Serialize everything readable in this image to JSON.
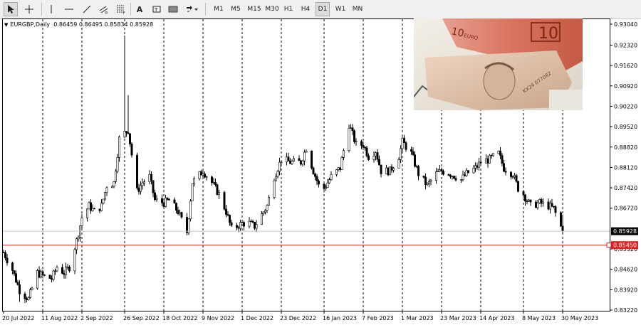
{
  "toolbar": {
    "timeframes": [
      "M1",
      "M5",
      "M15",
      "M30",
      "H1",
      "H4",
      "D1",
      "W1",
      "MN"
    ],
    "active_timeframe": "D1",
    "text_tool_label": "A"
  },
  "symbol": {
    "name": "EURGBP,Daily",
    "ohlc": "0.86459 0.86495 0.85834 0.85928"
  },
  "price_axis": {
    "ticks": [
      "0.93040",
      "0.92320",
      "0.91620",
      "0.90920",
      "0.90220",
      "0.89520",
      "0.88820",
      "0.88120",
      "0.87420",
      "0.86720",
      "0.85320",
      "0.84620",
      "0.83920",
      "0.83220"
    ],
    "current_price": "0.85928",
    "line_price": "0.85450"
  },
  "time_axis": {
    "labels": [
      "20 Jul 2022",
      "11 Aug 2022",
      "2 Sep 2022",
      "26 Sep 2022",
      "18 Oct 2022",
      "9 Nov 2022",
      "1 Dec 2022",
      "23 Dec 2022",
      "16 Jan 2023",
      "7 Feb 2023",
      "1 Mar 2023",
      "23 Mar 2023",
      "14 Apr 2023",
      "8 May 2023",
      "30 May 2023"
    ]
  },
  "colors": {
    "horizontal_line": "#e02020",
    "current_price_box": "#000000",
    "candles": "#000000"
  },
  "photo": {
    "icon": "euro-and-pound-banknotes"
  },
  "chart_data": {
    "type": "candlestick",
    "symbol": "EURGBP",
    "timeframe": "Daily",
    "ylim": [
      0.8322,
      0.9304
    ],
    "close_path": [
      [
        "2022-07-20",
        0.852
      ],
      [
        "2022-07-25",
        0.846
      ],
      [
        "2022-07-29",
        0.839
      ],
      [
        "2022-08-03",
        0.836
      ],
      [
        "2022-08-08",
        0.845
      ],
      [
        "2022-08-11",
        0.844
      ],
      [
        "2022-08-16",
        0.843
      ],
      [
        "2022-08-19",
        0.847
      ],
      [
        "2022-08-23",
        0.845
      ],
      [
        "2022-08-26",
        0.847
      ],
      [
        "2022-08-30",
        0.856
      ],
      [
        "2022-09-02",
        0.864
      ],
      [
        "2022-09-06",
        0.868
      ],
      [
        "2022-09-09",
        0.866
      ],
      [
        "2022-09-13",
        0.868
      ],
      [
        "2022-09-16",
        0.875
      ],
      [
        "2022-09-20",
        0.876
      ],
      [
        "2022-09-23",
        0.891
      ],
      [
        "2022-09-26",
        0.893
      ],
      [
        "2022-09-28",
        0.894
      ],
      [
        "2022-10-03",
        0.873
      ],
      [
        "2022-10-06",
        0.876
      ],
      [
        "2022-10-10",
        0.878
      ],
      [
        "2022-10-13",
        0.87
      ],
      [
        "2022-10-18",
        0.869
      ],
      [
        "2022-10-21",
        0.87
      ],
      [
        "2022-10-26",
        0.866
      ],
      [
        "2022-10-31",
        0.859
      ],
      [
        "2022-11-03",
        0.876
      ],
      [
        "2022-11-09",
        0.88
      ],
      [
        "2022-11-14",
        0.876
      ],
      [
        "2022-11-18",
        0.872
      ],
      [
        "2022-11-22",
        0.866
      ],
      [
        "2022-11-25",
        0.86
      ],
      [
        "2022-12-01",
        0.862
      ],
      [
        "2022-12-05",
        0.862
      ],
      [
        "2022-12-08",
        0.861
      ],
      [
        "2022-12-12",
        0.865
      ],
      [
        "2022-12-15",
        0.868
      ],
      [
        "2022-12-19",
        0.878
      ],
      [
        "2022-12-23",
        0.884
      ],
      [
        "2022-12-28",
        0.883
      ],
      [
        "2023-01-03",
        0.883
      ],
      [
        "2023-01-06",
        0.888
      ],
      [
        "2023-01-10",
        0.88
      ],
      [
        "2023-01-13",
        0.875
      ],
      [
        "2023-01-16",
        0.874
      ],
      [
        "2023-01-20",
        0.878
      ],
      [
        "2023-01-25",
        0.881
      ],
      [
        "2023-01-30",
        0.896
      ],
      [
        "2023-02-03",
        0.889
      ],
      [
        "2023-02-07",
        0.889
      ],
      [
        "2023-02-10",
        0.885
      ],
      [
        "2023-02-14",
        0.887
      ],
      [
        "2023-02-17",
        0.88
      ],
      [
        "2023-02-22",
        0.88
      ],
      [
        "2023-02-27",
        0.885
      ],
      [
        "2023-03-01",
        0.89
      ],
      [
        "2023-03-06",
        0.886
      ],
      [
        "2023-03-10",
        0.879
      ],
      [
        "2023-03-15",
        0.875
      ],
      [
        "2023-03-20",
        0.879
      ],
      [
        "2023-03-23",
        0.88
      ],
      [
        "2023-03-28",
        0.879
      ],
      [
        "2023-04-03",
        0.877
      ],
      [
        "2023-04-06",
        0.879
      ],
      [
        "2023-04-11",
        0.881
      ],
      [
        "2023-04-14",
        0.883
      ],
      [
        "2023-04-19",
        0.884
      ],
      [
        "2023-04-24",
        0.886
      ],
      [
        "2023-04-27",
        0.881
      ],
      [
        "2023-05-02",
        0.879
      ],
      [
        "2023-05-05",
        0.874
      ],
      [
        "2023-05-08",
        0.872
      ],
      [
        "2023-05-12",
        0.868
      ],
      [
        "2023-05-17",
        0.869
      ],
      [
        "2023-05-22",
        0.868
      ],
      [
        "2023-05-25",
        0.867
      ],
      [
        "2023-05-30",
        0.8593
      ]
    ]
  }
}
